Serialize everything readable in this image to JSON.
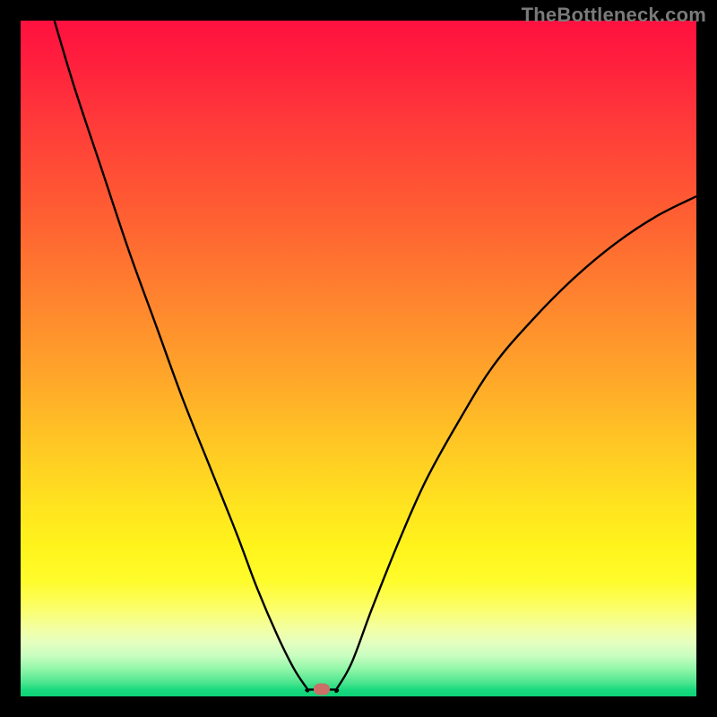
{
  "watermark": "TheBottleneck.com",
  "marker": {
    "x_pct": 44.6,
    "y_pct": 99.0
  },
  "chart_data": {
    "type": "line",
    "title": "",
    "xlabel": "",
    "ylabel": "",
    "xlim": [
      0,
      100
    ],
    "ylim": [
      0,
      100
    ],
    "grid": false,
    "legend": false,
    "background_gradient": "vertical red→orange→yellow→green (bottleneck heat)",
    "series": [
      {
        "name": "left-descent",
        "x": [
          5.0,
          8.0,
          12.0,
          16.0,
          20.0,
          24.0,
          28.0,
          32.0,
          35.0,
          38.0,
          40.5,
          42.5
        ],
        "y": [
          100.0,
          90.0,
          78.0,
          66.0,
          55.0,
          44.0,
          34.0,
          24.0,
          16.0,
          9.0,
          4.0,
          1.0
        ]
      },
      {
        "name": "flat-bottom",
        "x": [
          42.5,
          46.7
        ],
        "y": [
          1.0,
          1.0
        ]
      },
      {
        "name": "right-ascent",
        "x": [
          46.7,
          49.0,
          52.0,
          56.0,
          60.0,
          65.0,
          70.0,
          76.0,
          82.0,
          88.0,
          94.0,
          100.0
        ],
        "y": [
          1.0,
          5.0,
          13.0,
          23.0,
          32.0,
          41.0,
          49.0,
          56.0,
          62.0,
          67.0,
          71.0,
          74.0
        ]
      }
    ],
    "marker_point": {
      "x": 44.6,
      "y": 1.0,
      "color": "#ca7066",
      "name": "optimal-point"
    }
  }
}
